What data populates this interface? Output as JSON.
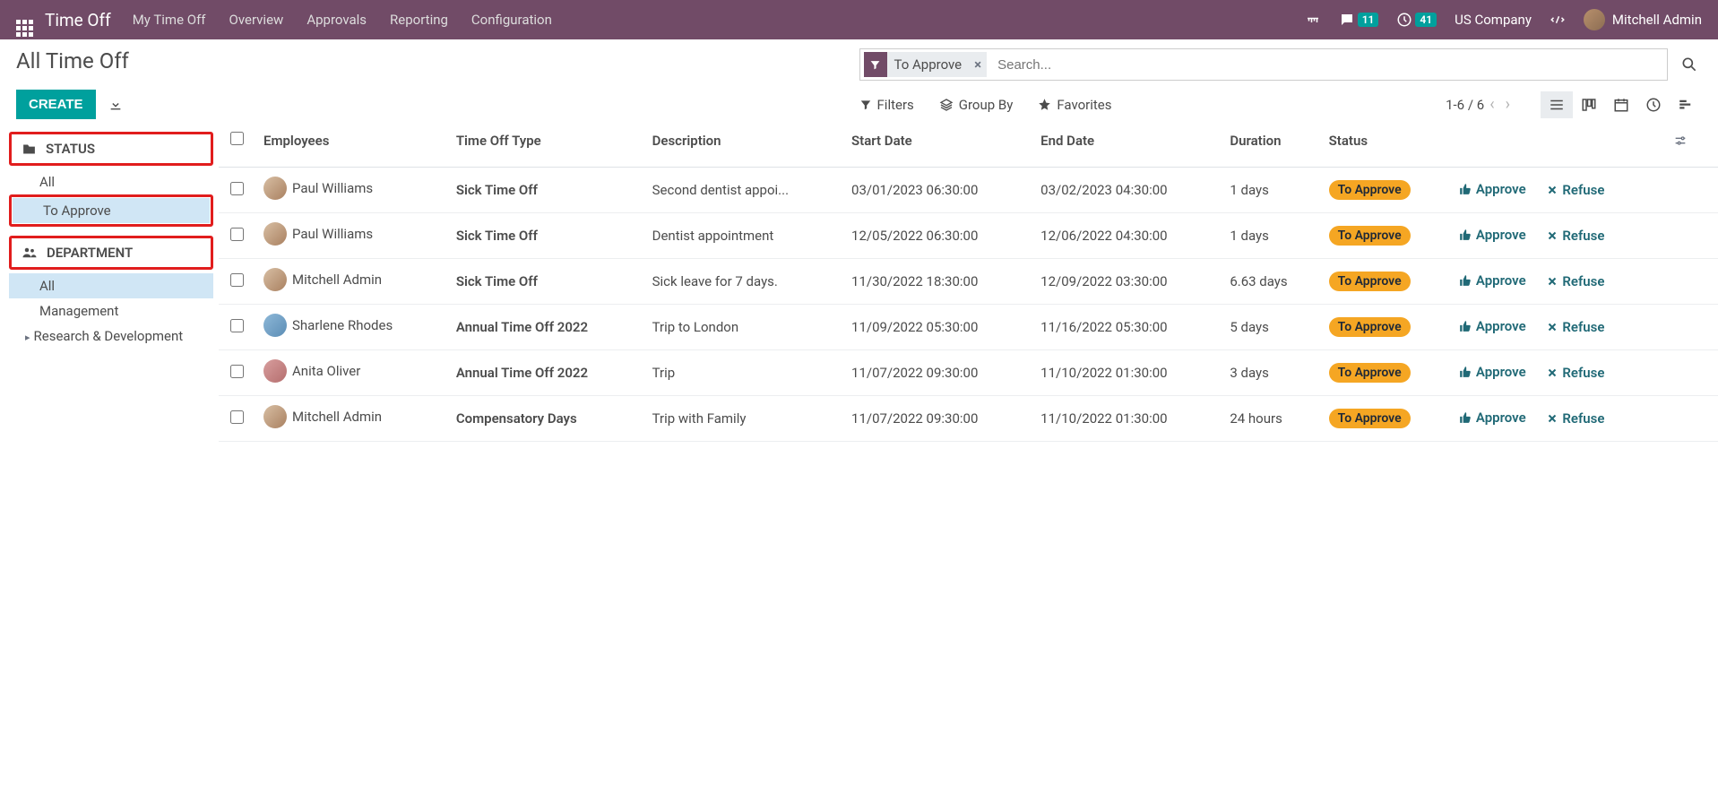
{
  "topnav": {
    "app_title": "Time Off",
    "menu": [
      "My Time Off",
      "Overview",
      "Approvals",
      "Reporting",
      "Configuration"
    ],
    "msg_badge": "11",
    "activity_badge": "41",
    "company": "US Company",
    "user_name": "Mitchell Admin"
  },
  "control": {
    "page_title": "All Time Off",
    "create_label": "CREATE",
    "search_facet": "To Approve",
    "search_placeholder": "Search...",
    "filters_label": "Filters",
    "groupby_label": "Group By",
    "favorites_label": "Favorites",
    "pager_text": "1-6 / 6"
  },
  "sidebar": {
    "status_header": "STATUS",
    "status_items": {
      "all": "All",
      "to_approve": "To Approve"
    },
    "dept_header": "DEPARTMENT",
    "dept_items": {
      "all": "All",
      "mgmt": "Management",
      "rnd": "Research & Development"
    }
  },
  "table": {
    "headers": {
      "employees": "Employees",
      "type": "Time Off Type",
      "desc": "Description",
      "start": "Start Date",
      "end": "End Date",
      "duration": "Duration",
      "status": "Status"
    },
    "approve_label": "Approve",
    "refuse_label": "Refuse",
    "status_pill": "To Approve",
    "rows": [
      {
        "emp": "Paul Williams",
        "av": "",
        "type": "Sick Time Off",
        "desc": "Second dentist appoi...",
        "start": "03/01/2023 06:30:00",
        "end": "03/02/2023 04:30:00",
        "dur": "1 days"
      },
      {
        "emp": "Paul Williams",
        "av": "",
        "type": "Sick Time Off",
        "desc": "Dentist appointment",
        "start": "12/05/2022 06:30:00",
        "end": "12/06/2022 04:30:00",
        "dur": "1 days"
      },
      {
        "emp": "Mitchell Admin",
        "av": "",
        "type": "Sick Time Off",
        "desc": "Sick leave for 7 days.",
        "start": "11/30/2022 18:30:00",
        "end": "12/09/2022 03:30:00",
        "dur": "6.63 days"
      },
      {
        "emp": "Sharlene Rhodes",
        "av": "blue",
        "type": "Annual Time Off 2022",
        "desc": "Trip to London",
        "start": "11/09/2022 05:30:00",
        "end": "11/16/2022 05:30:00",
        "dur": "5 days"
      },
      {
        "emp": "Anita Oliver",
        "av": "red",
        "type": "Annual Time Off 2022",
        "desc": "Trip",
        "start": "11/07/2022 09:30:00",
        "end": "11/10/2022 01:30:00",
        "dur": "3 days"
      },
      {
        "emp": "Mitchell Admin",
        "av": "",
        "type": "Compensatory Days",
        "desc": "Trip with Family",
        "start": "11/07/2022 09:30:00",
        "end": "11/10/2022 01:30:00",
        "dur": "24 hours"
      }
    ]
  }
}
